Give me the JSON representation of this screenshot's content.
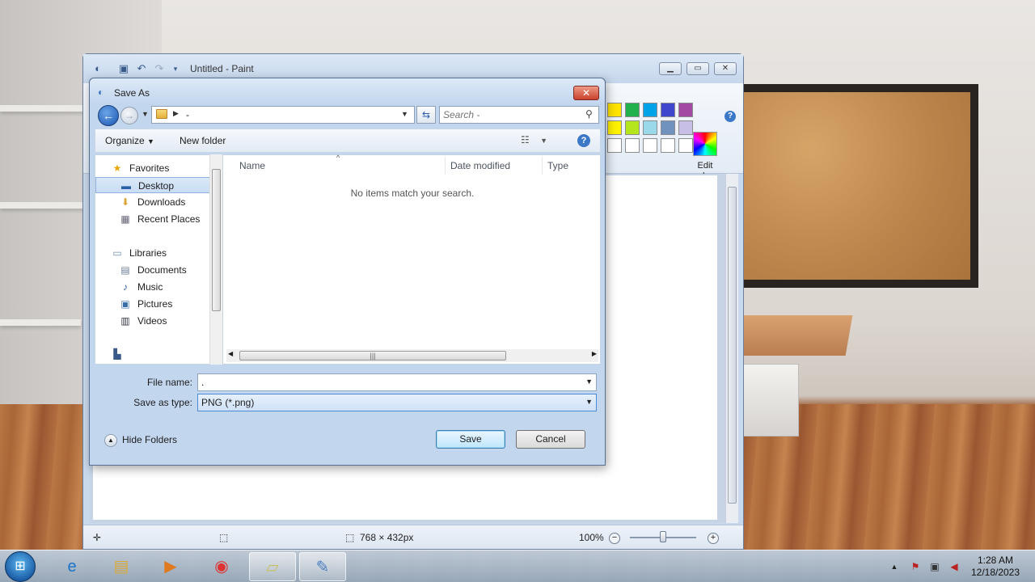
{
  "paint": {
    "title": "Untitled - Paint",
    "edit_colors_label": "Edit colors",
    "status_dimensions": "768 × 432px",
    "zoom": "100%",
    "palette_row1": [
      "#ffe400",
      "#22b14c",
      "#00a2e8",
      "#3f48cc",
      "#a349a4"
    ],
    "palette_row2": [
      "#fff200",
      "#b5e61d",
      "#99d9ea",
      "#7092be",
      "#c8bfe7"
    ]
  },
  "dialog": {
    "title": "Save As",
    "address_text": "-",
    "search_placeholder": "Search -",
    "toolbar": {
      "organize": "Organize",
      "new_folder": "New folder"
    },
    "nav": {
      "favorites": "Favorites",
      "desktop": "Desktop",
      "downloads": "Downloads",
      "recent_places": "Recent Places",
      "libraries": "Libraries",
      "documents": "Documents",
      "music": "Music",
      "pictures": "Pictures",
      "videos": "Videos"
    },
    "columns": {
      "name": "Name",
      "date_modified": "Date modified",
      "type": "Type"
    },
    "empty_message": "No items match your search.",
    "file_name_label": "File name:",
    "file_name_value": ".",
    "save_type_label": "Save as type:",
    "save_type_value": "PNG (*.png)",
    "hide_folders": "Hide Folders",
    "save_button": "Save",
    "cancel_button": "Cancel"
  },
  "taskbar": {
    "time": "1:28 AM",
    "date": "12/18/2023",
    "items": [
      "internet-explorer-icon",
      "file-explorer-icon",
      "media-player-icon",
      "chrome-icon",
      "sticky-notes-icon",
      "paint-icon"
    ]
  }
}
